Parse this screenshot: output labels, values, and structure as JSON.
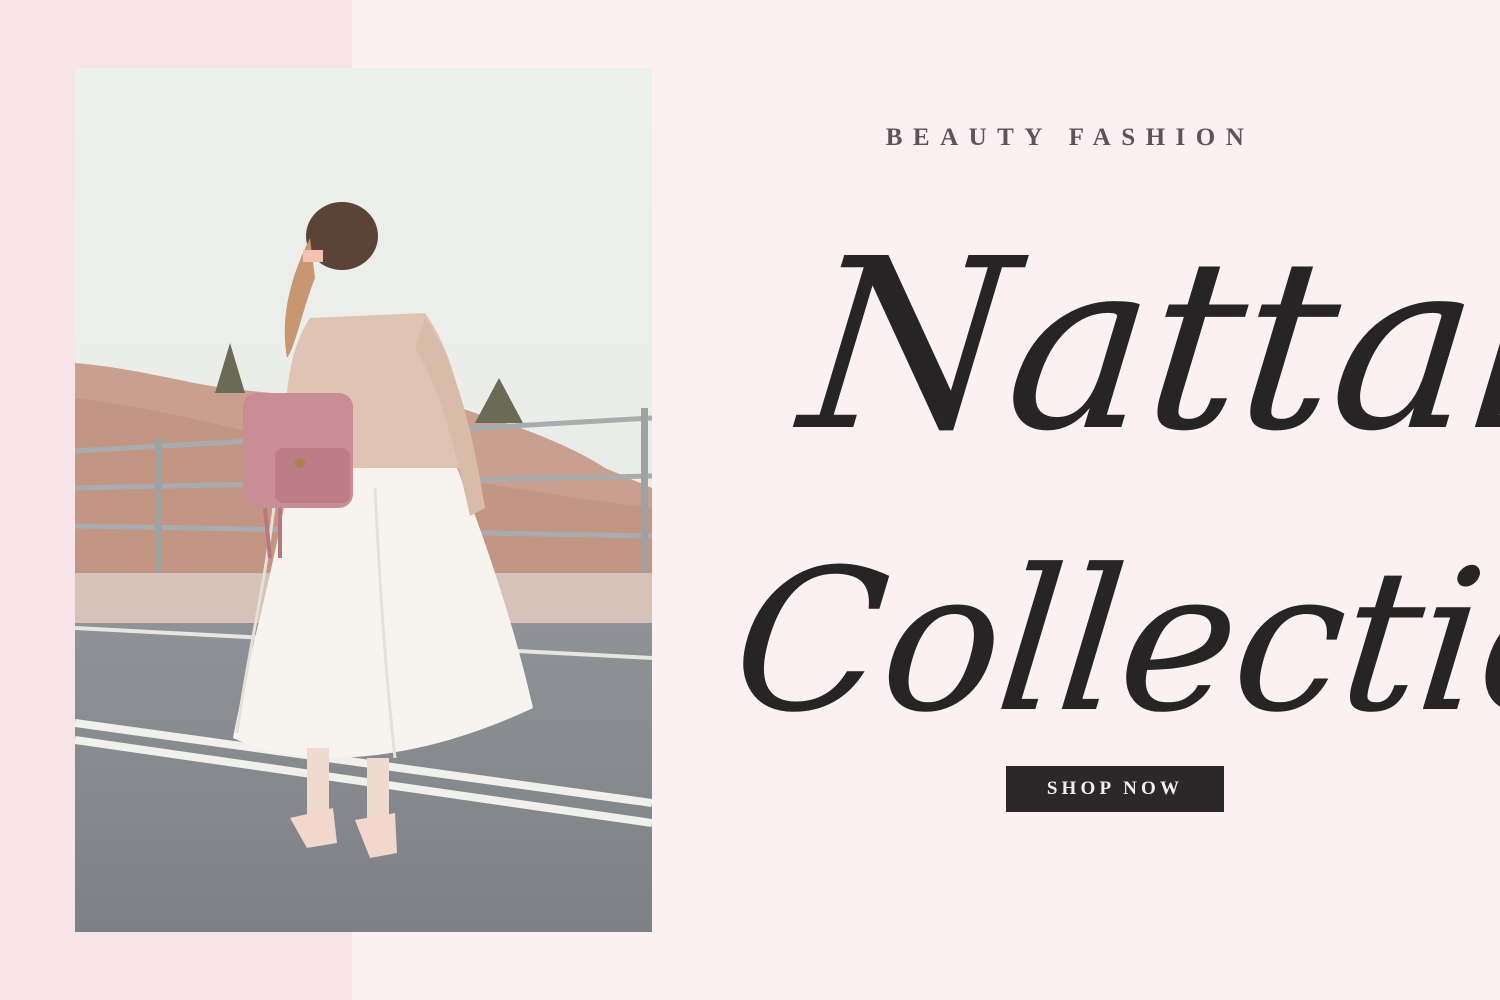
{
  "hero": {
    "eyebrow": "BEAUTY FASHION",
    "title_line1": "Nattalie",
    "title_line2": "Collection",
    "cta_label": "SHOP NOW"
  },
  "colors": {
    "background": "#fbf0f2",
    "left_panel": "#f7e4e8",
    "script_text": "#262424",
    "eyebrow_text": "#5b5459",
    "button_bg": "#2a2828",
    "button_text": "#f4eef0"
  },
  "photo": {
    "subject": "woman-in-tulle-skirt-with-pink-backpack"
  }
}
